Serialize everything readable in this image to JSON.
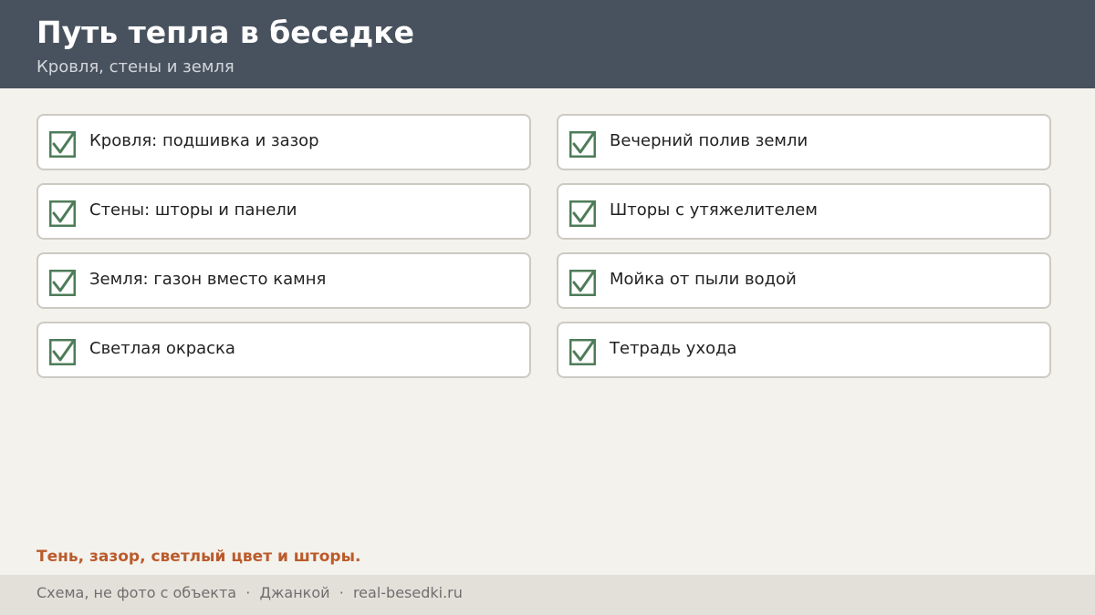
{
  "header": {
    "title": "Путь тепла в беседке",
    "subtitle": "Кровля, стены и земля"
  },
  "checklist": {
    "left": [
      {
        "label": "Кровля: подшивка и зазор",
        "checked": true
      },
      {
        "label": "Стены: шторы и панели",
        "checked": true
      },
      {
        "label": "Земля: газон вместо камня",
        "checked": true
      },
      {
        "label": "Светлая окраска",
        "checked": true
      }
    ],
    "right": [
      {
        "label": "Вечерний полив земли",
        "checked": true
      },
      {
        "label": "Шторы с утяжелителем",
        "checked": true
      },
      {
        "label": "Мойка от пыли водой",
        "checked": true
      },
      {
        "label": "Тетрадь ухода",
        "checked": true
      }
    ],
    "icon": "checkbox-checked-icon",
    "check_color": "#4e7c59"
  },
  "tagline": "Тень, зазор, светлый цвет и шторы.",
  "footer": {
    "text": "Схема, не фото с объекта  ·  Джанкой  ·  real-besedki.ru"
  },
  "colors": {
    "header_bg": "#48525e",
    "accent": "#bb5b2b",
    "page_bg": "#f4f2ed",
    "footer_bg": "#e3e0d9"
  }
}
